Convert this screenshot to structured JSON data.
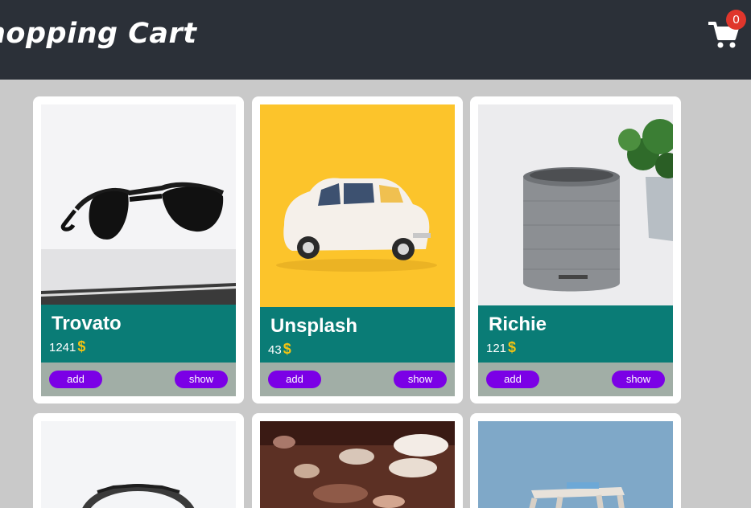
{
  "header": {
    "title": "hopping Cart",
    "cart_icon": "shopping-cart-icon",
    "cart_count": "0"
  },
  "products": [
    {
      "name": "Trovato",
      "price": "1241",
      "currency": "$",
      "add_label": "add",
      "show_label": "show",
      "image": "sunglasses"
    },
    {
      "name": "Unsplash",
      "price": "43",
      "currency": "$",
      "add_label": "add",
      "show_label": "show",
      "image": "toy-car"
    },
    {
      "name": "Richie",
      "price": "121",
      "currency": "$",
      "add_label": "add",
      "show_label": "show",
      "image": "smart-speaker"
    },
    {
      "image": "headband"
    },
    {
      "image": "bokeh-lights"
    },
    {
      "image": "wooden-stool"
    }
  ],
  "colors": {
    "header_bg": "#2b3038",
    "page_bg": "#c9c9c9",
    "info_bg": "#0a7c76",
    "button_bg": "#7b00e6",
    "actions_bg": "#a1aea6",
    "currency": "#f2c313",
    "badge": "#e0362c"
  }
}
